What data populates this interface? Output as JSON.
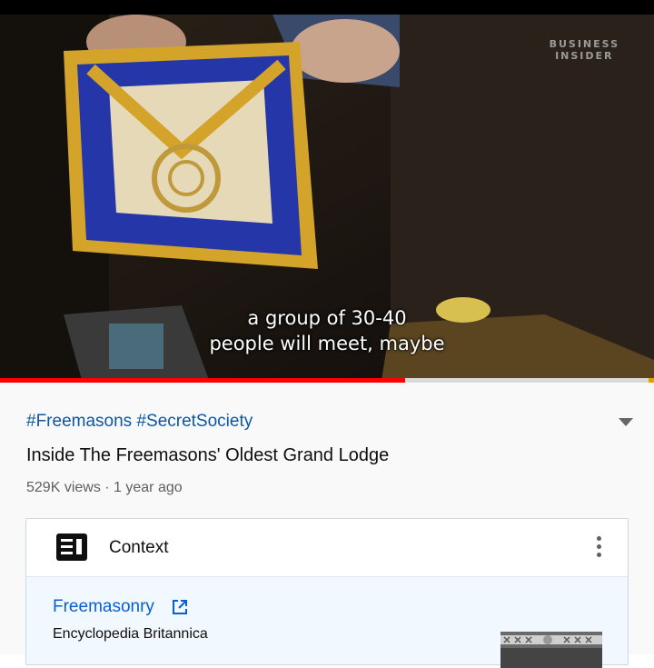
{
  "video": {
    "watermark_line1": "BUSINESS",
    "watermark_line2": "INSIDER",
    "caption_line1": "a group of 30-40",
    "caption_line2": "people will meet, maybe",
    "progress": 0.62
  },
  "details": {
    "hashtag1": "#Freemasons",
    "hashtag2": "#SecretSociety",
    "title": "Inside The Freemasons' Oldest Grand Lodge",
    "meta": "529K views · 1 year ago"
  },
  "context_card": {
    "header_label": "Context",
    "link_text": "Freemasonry",
    "source": "Encyclopedia Britannica"
  },
  "colors": {
    "progress": "#ff0000",
    "link": "#065fd4"
  }
}
